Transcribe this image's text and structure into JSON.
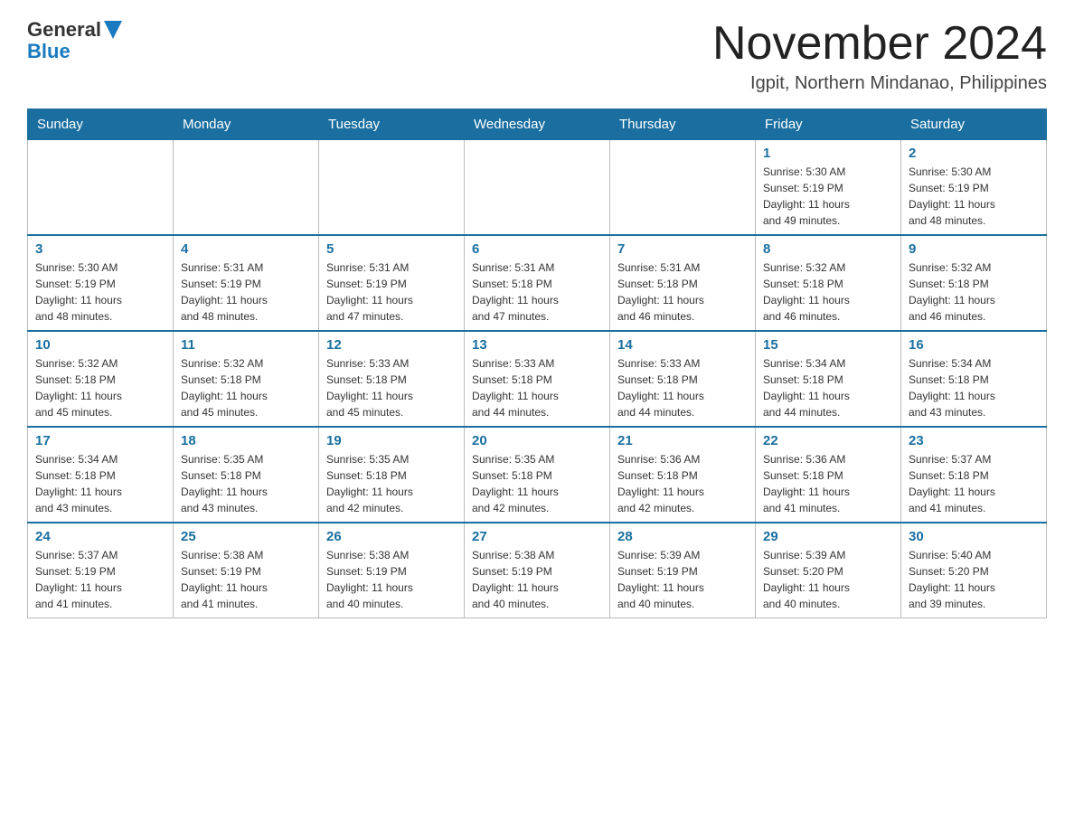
{
  "header": {
    "logo": {
      "general": "General",
      "arrow": "▶",
      "blue": "Blue"
    },
    "title": "November 2024",
    "location": "Igpit, Northern Mindanao, Philippines"
  },
  "calendar": {
    "days_of_week": [
      "Sunday",
      "Monday",
      "Tuesday",
      "Wednesday",
      "Thursday",
      "Friday",
      "Saturday"
    ],
    "weeks": [
      {
        "days": [
          {
            "number": "",
            "info": ""
          },
          {
            "number": "",
            "info": ""
          },
          {
            "number": "",
            "info": ""
          },
          {
            "number": "",
            "info": ""
          },
          {
            "number": "",
            "info": ""
          },
          {
            "number": "1",
            "info": "Sunrise: 5:30 AM\nSunset: 5:19 PM\nDaylight: 11 hours\nand 49 minutes."
          },
          {
            "number": "2",
            "info": "Sunrise: 5:30 AM\nSunset: 5:19 PM\nDaylight: 11 hours\nand 48 minutes."
          }
        ]
      },
      {
        "days": [
          {
            "number": "3",
            "info": "Sunrise: 5:30 AM\nSunset: 5:19 PM\nDaylight: 11 hours\nand 48 minutes."
          },
          {
            "number": "4",
            "info": "Sunrise: 5:31 AM\nSunset: 5:19 PM\nDaylight: 11 hours\nand 48 minutes."
          },
          {
            "number": "5",
            "info": "Sunrise: 5:31 AM\nSunset: 5:19 PM\nDaylight: 11 hours\nand 47 minutes."
          },
          {
            "number": "6",
            "info": "Sunrise: 5:31 AM\nSunset: 5:18 PM\nDaylight: 11 hours\nand 47 minutes."
          },
          {
            "number": "7",
            "info": "Sunrise: 5:31 AM\nSunset: 5:18 PM\nDaylight: 11 hours\nand 46 minutes."
          },
          {
            "number": "8",
            "info": "Sunrise: 5:32 AM\nSunset: 5:18 PM\nDaylight: 11 hours\nand 46 minutes."
          },
          {
            "number": "9",
            "info": "Sunrise: 5:32 AM\nSunset: 5:18 PM\nDaylight: 11 hours\nand 46 minutes."
          }
        ]
      },
      {
        "days": [
          {
            "number": "10",
            "info": "Sunrise: 5:32 AM\nSunset: 5:18 PM\nDaylight: 11 hours\nand 45 minutes."
          },
          {
            "number": "11",
            "info": "Sunrise: 5:32 AM\nSunset: 5:18 PM\nDaylight: 11 hours\nand 45 minutes."
          },
          {
            "number": "12",
            "info": "Sunrise: 5:33 AM\nSunset: 5:18 PM\nDaylight: 11 hours\nand 45 minutes."
          },
          {
            "number": "13",
            "info": "Sunrise: 5:33 AM\nSunset: 5:18 PM\nDaylight: 11 hours\nand 44 minutes."
          },
          {
            "number": "14",
            "info": "Sunrise: 5:33 AM\nSunset: 5:18 PM\nDaylight: 11 hours\nand 44 minutes."
          },
          {
            "number": "15",
            "info": "Sunrise: 5:34 AM\nSunset: 5:18 PM\nDaylight: 11 hours\nand 44 minutes."
          },
          {
            "number": "16",
            "info": "Sunrise: 5:34 AM\nSunset: 5:18 PM\nDaylight: 11 hours\nand 43 minutes."
          }
        ]
      },
      {
        "days": [
          {
            "number": "17",
            "info": "Sunrise: 5:34 AM\nSunset: 5:18 PM\nDaylight: 11 hours\nand 43 minutes."
          },
          {
            "number": "18",
            "info": "Sunrise: 5:35 AM\nSunset: 5:18 PM\nDaylight: 11 hours\nand 43 minutes."
          },
          {
            "number": "19",
            "info": "Sunrise: 5:35 AM\nSunset: 5:18 PM\nDaylight: 11 hours\nand 42 minutes."
          },
          {
            "number": "20",
            "info": "Sunrise: 5:35 AM\nSunset: 5:18 PM\nDaylight: 11 hours\nand 42 minutes."
          },
          {
            "number": "21",
            "info": "Sunrise: 5:36 AM\nSunset: 5:18 PM\nDaylight: 11 hours\nand 42 minutes."
          },
          {
            "number": "22",
            "info": "Sunrise: 5:36 AM\nSunset: 5:18 PM\nDaylight: 11 hours\nand 41 minutes."
          },
          {
            "number": "23",
            "info": "Sunrise: 5:37 AM\nSunset: 5:18 PM\nDaylight: 11 hours\nand 41 minutes."
          }
        ]
      },
      {
        "days": [
          {
            "number": "24",
            "info": "Sunrise: 5:37 AM\nSunset: 5:19 PM\nDaylight: 11 hours\nand 41 minutes."
          },
          {
            "number": "25",
            "info": "Sunrise: 5:38 AM\nSunset: 5:19 PM\nDaylight: 11 hours\nand 41 minutes."
          },
          {
            "number": "26",
            "info": "Sunrise: 5:38 AM\nSunset: 5:19 PM\nDaylight: 11 hours\nand 40 minutes."
          },
          {
            "number": "27",
            "info": "Sunrise: 5:38 AM\nSunset: 5:19 PM\nDaylight: 11 hours\nand 40 minutes."
          },
          {
            "number": "28",
            "info": "Sunrise: 5:39 AM\nSunset: 5:19 PM\nDaylight: 11 hours\nand 40 minutes."
          },
          {
            "number": "29",
            "info": "Sunrise: 5:39 AM\nSunset: 5:20 PM\nDaylight: 11 hours\nand 40 minutes."
          },
          {
            "number": "30",
            "info": "Sunrise: 5:40 AM\nSunset: 5:20 PM\nDaylight: 11 hours\nand 39 minutes."
          }
        ]
      }
    ]
  }
}
